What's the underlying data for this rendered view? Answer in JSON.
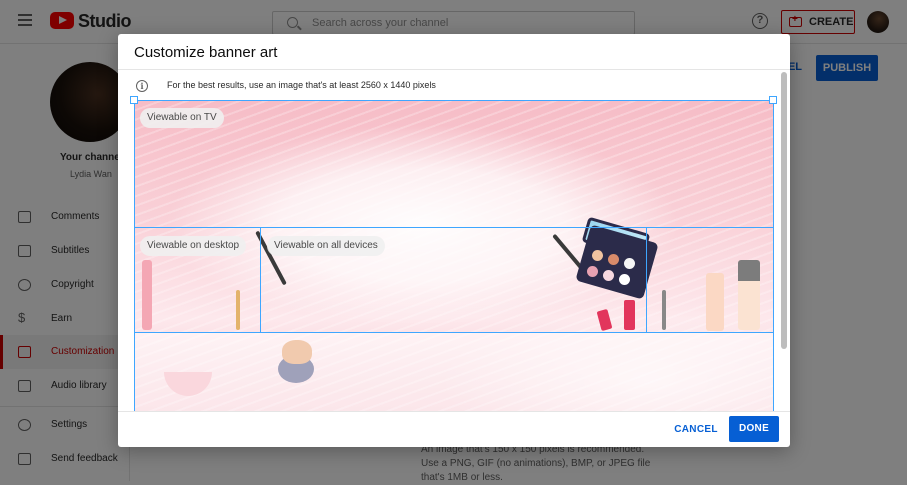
{
  "app": {
    "logo_text": "Studio",
    "search_placeholder": "Search across your channel",
    "help_glyph": "?",
    "create_label": "CREATE"
  },
  "sidebar": {
    "channel_title": "Your channel",
    "channel_name": "Lydia Wan",
    "items": [
      {
        "label": "Comments",
        "icon": "comments-icon"
      },
      {
        "label": "Subtitles",
        "icon": "subtitles-icon"
      },
      {
        "label": "Copyright",
        "icon": "copyright-icon"
      },
      {
        "label": "Earn",
        "icon": "dollar-icon"
      },
      {
        "label": "Customization",
        "icon": "magic-wand-icon",
        "active": true
      },
      {
        "label": "Audio library",
        "icon": "audio-library-icon"
      },
      {
        "label": "Settings",
        "icon": "gear-icon"
      },
      {
        "label": "Send feedback",
        "icon": "feedback-icon"
      }
    ]
  },
  "page": {
    "cancel_label": "CEL",
    "publish_label": "PUBLISH",
    "bg_text": "An image that's 150 x 150 pixels is recommended. Use a PNG, GIF (no animations), BMP, or JPEG file that's 1MB or less."
  },
  "dialog": {
    "title": "Customize banner art",
    "info_glyph": "i",
    "info_text": "For the best results, use an image that's at least 2560 x 1440 pixels",
    "chips": {
      "tv": "Viewable on TV",
      "desktop": "Viewable on desktop",
      "all": "Viewable on all devices"
    },
    "cancel_label": "CANCEL",
    "done_label": "DONE"
  },
  "colors": {
    "accent": "#065fd4",
    "brand_red": "#ff0000",
    "crop_frame": "#3ea6ff",
    "active_nav": "#cc0000"
  }
}
